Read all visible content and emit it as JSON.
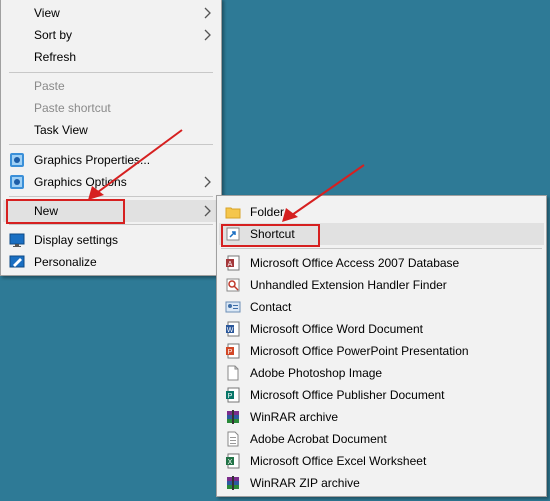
{
  "context_menu": {
    "view": "View",
    "sort_by": "Sort by",
    "refresh": "Refresh",
    "paste": "Paste",
    "paste_shortcut": "Paste shortcut",
    "task_view": "Task View",
    "graphics_properties": "Graphics Properties...",
    "graphics_options": "Graphics Options",
    "new": "New",
    "display_settings": "Display settings",
    "personalize": "Personalize"
  },
  "new_submenu": {
    "folder": "Folder",
    "shortcut": "Shortcut",
    "access": "Microsoft Office Access 2007 Database",
    "unhandled": "Unhandled Extension Handler Finder",
    "contact": "Contact",
    "word": "Microsoft Office Word Document",
    "powerpoint": "Microsoft Office PowerPoint Presentation",
    "photoshop": "Adobe Photoshop Image",
    "publisher": "Microsoft Office Publisher Document",
    "winrar": "WinRAR archive",
    "acrobat": "Adobe Acrobat Document",
    "excel": "Microsoft Office Excel Worksheet",
    "winrar_zip": "WinRAR ZIP archive"
  },
  "colors": {
    "desktop": "#2e7a96",
    "menu_bg": "#f2f2f2",
    "highlight_box": "#d62020"
  }
}
